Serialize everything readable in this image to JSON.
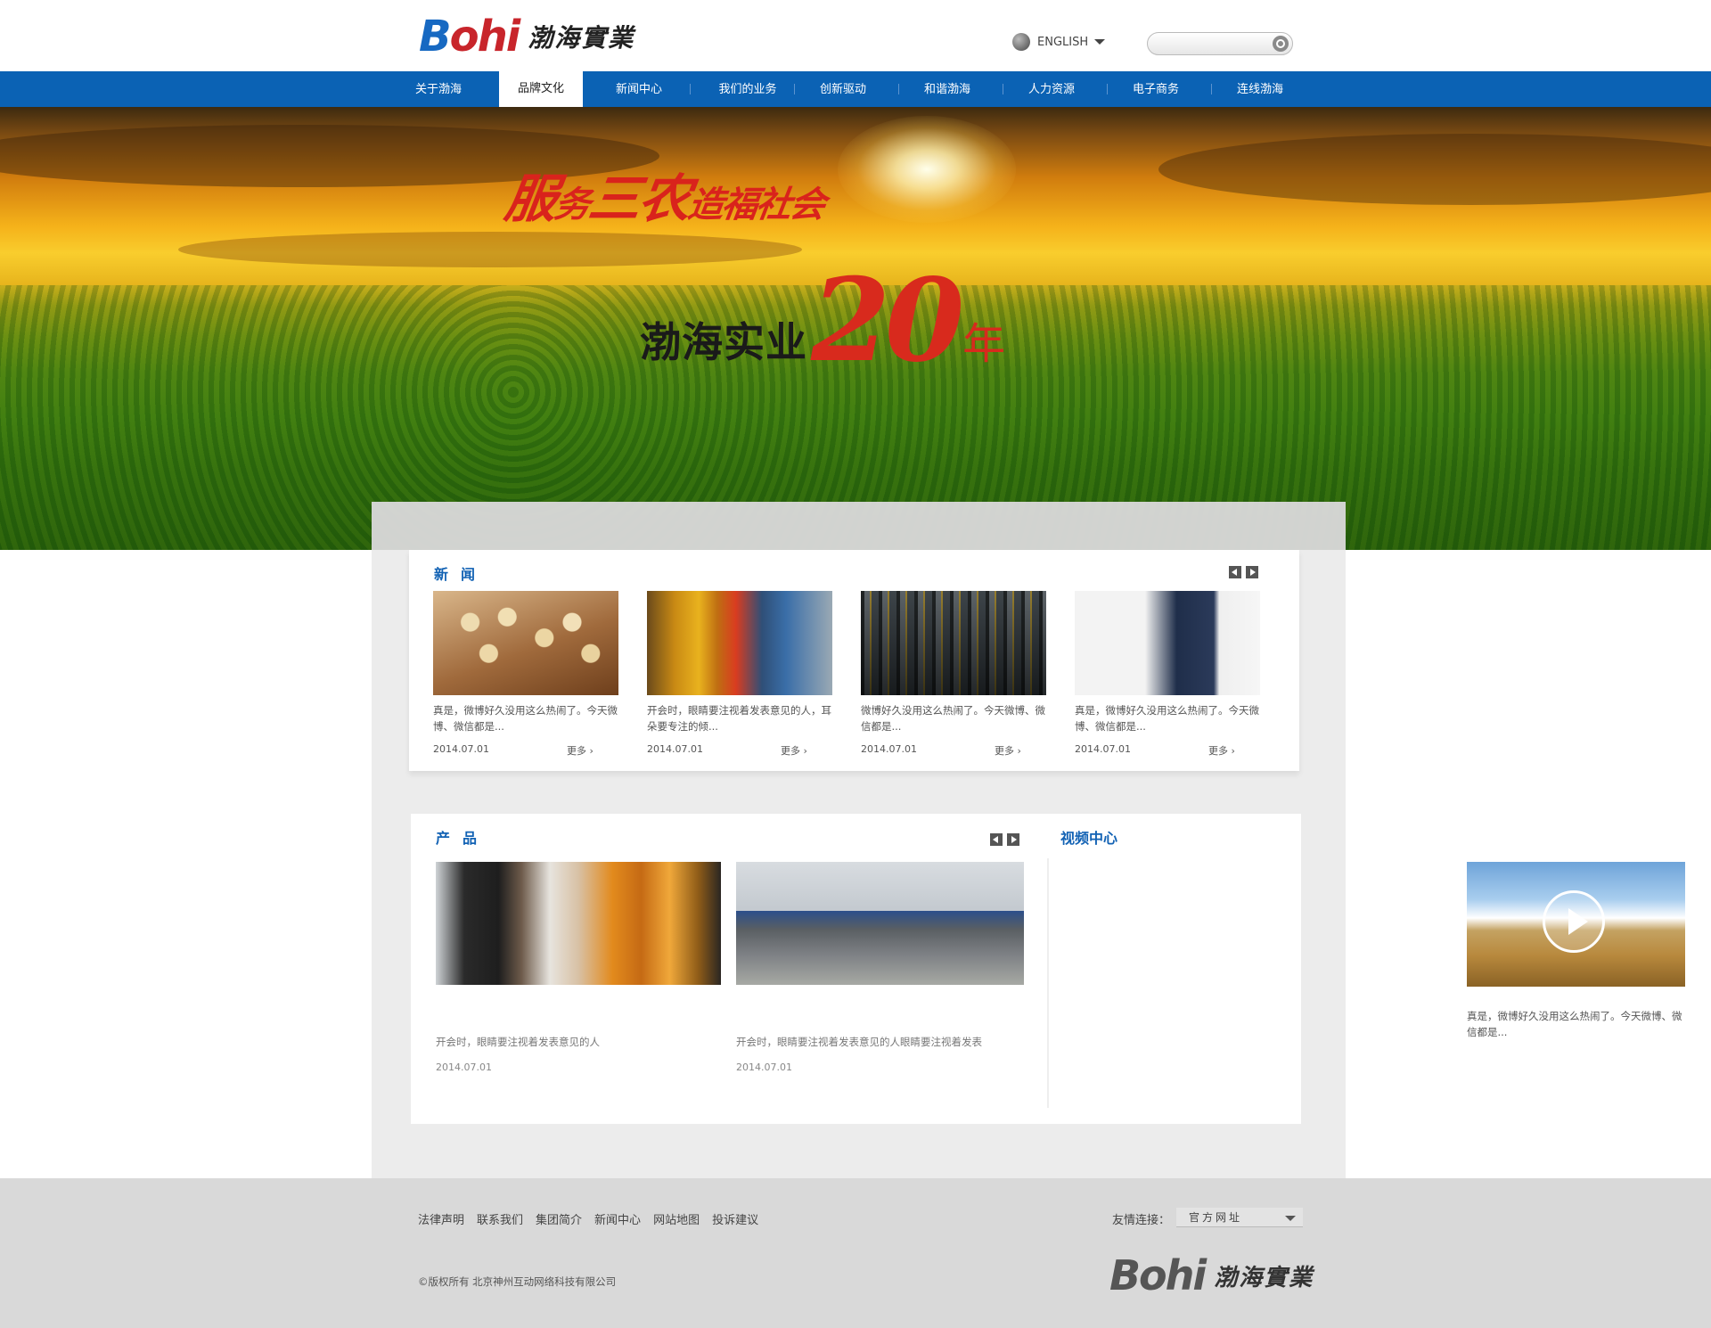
{
  "header": {
    "logo_latin": "Bohi",
    "logo_cn": "渤海實業",
    "lang_label": "ENGLISH",
    "search_placeholder": ""
  },
  "nav": {
    "items": [
      {
        "label": "关于渤海"
      },
      {
        "label": "品牌文化",
        "active": true
      },
      {
        "label": "新闻中心"
      },
      {
        "label": "我们的业务"
      },
      {
        "label": "创新驱动"
      },
      {
        "label": "和谐渤海"
      },
      {
        "label": "人力资源"
      },
      {
        "label": "电子商务"
      },
      {
        "label": "连线渤海"
      }
    ]
  },
  "banner": {
    "slogan_1": "服",
    "slogan_2": "务",
    "slogan_3": "三农",
    "slogan_4": "造福社会",
    "company": "渤海实业",
    "years_num": "20",
    "years_unit": "年"
  },
  "news": {
    "title": "新闻",
    "more_label": "更多 ›",
    "items": [
      {
        "text": "真是，微博好久没用这么热闹了。今天微博、微信都是...",
        "date": "2014.07.01",
        "image": "soybeans"
      },
      {
        "text": "开会时，眼睛要注视着发表意见的人，耳朵要专注的倾...",
        "date": "2014.07.01",
        "image": "oil-bottles"
      },
      {
        "text": "微博好久没用这么热闹了。今天微博、微信都是...",
        "date": "2014.07.01",
        "image": "factory-machinery"
      },
      {
        "text": "真是，微博好久没用这么热闹了。今天微博、微信都是...",
        "date": "2014.07.01",
        "image": "speaker"
      }
    ]
  },
  "products": {
    "title": "产品",
    "items": [
      {
        "text": "开会时，眼睛要注视着发表意见的人",
        "date": "2014.07.01",
        "image": "visit"
      },
      {
        "text": "开会时，眼睛要注视着发表意见的人眼睛要注视着发表",
        "date": "2014.07.01",
        "image": "plant"
      }
    ]
  },
  "video": {
    "title": "视频中心",
    "text": "真是，微博好久没用这么热闹了。今天微博、微信都是...",
    "image": "wheat-field"
  },
  "footer": {
    "links": [
      "法律声明",
      "联系我们",
      "集团简介",
      "新闻中心",
      "网站地图",
      "投诉建议"
    ],
    "friend_label": "友情连接：",
    "friend_select": "官方网址",
    "copyright": "©版权所有  北京神州互动网络科技有限公司",
    "logo_latin": "Bohi",
    "logo_cn": "渤海實業"
  },
  "colors": {
    "nav_blue": "#0b62b4",
    "accent_red": "#c9242a",
    "title_blue": "#1262b4",
    "footer_bg": "#d9d9d9"
  }
}
